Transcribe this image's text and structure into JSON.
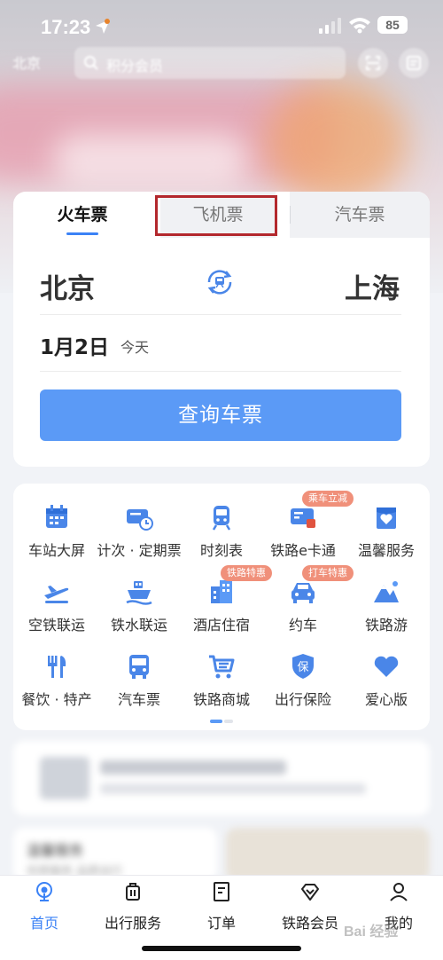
{
  "status_bar": {
    "time": "17:23",
    "battery": "85"
  },
  "header": {
    "city": "北京",
    "search_placeholder": "积分会员"
  },
  "booking": {
    "tabs": [
      {
        "label": "火车票",
        "active": true
      },
      {
        "label": "飞机票",
        "active": false
      },
      {
        "label": "汽车票",
        "active": false
      }
    ],
    "from_city": "北京",
    "to_city": "上海",
    "date": "1月2日",
    "date_note": "今天",
    "query_button": "查询车票"
  },
  "services": [
    {
      "label": "车站大屏",
      "icon": "station-screen-icon"
    },
    {
      "label": "计次 · 定期票",
      "icon": "ticket-pass-icon"
    },
    {
      "label": "时刻表",
      "icon": "train-icon"
    },
    {
      "label": "铁路e卡通",
      "icon": "e-card-icon",
      "badge": "乘车立减"
    },
    {
      "label": "温馨服务",
      "icon": "care-service-icon"
    },
    {
      "label": "空铁联运",
      "icon": "air-rail-icon"
    },
    {
      "label": "铁水联运",
      "icon": "ship-rail-icon"
    },
    {
      "label": "酒店住宿",
      "icon": "hotel-icon",
      "badge": "铁路特惠"
    },
    {
      "label": "约车",
      "icon": "car-icon",
      "badge": "打车特惠"
    },
    {
      "label": "铁路游",
      "icon": "mountain-travel-icon"
    },
    {
      "label": "餐饮 · 特产",
      "icon": "dining-icon"
    },
    {
      "label": "汽车票",
      "icon": "bus-icon"
    },
    {
      "label": "铁路商城",
      "icon": "shopping-cart-icon"
    },
    {
      "label": "出行保险",
      "icon": "insurance-shield-icon",
      "icon_text": "保"
    },
    {
      "label": "爱心版",
      "icon": "heart-icon"
    }
  ],
  "lower": {
    "promo_title": "温馨服务",
    "promo_sub": "优质服务 品质出行"
  },
  "nav": [
    {
      "label": "首页",
      "icon": "home-icon",
      "active": true
    },
    {
      "label": "出行服务",
      "icon": "luggage-icon",
      "active": false
    },
    {
      "label": "订单",
      "icon": "order-icon",
      "active": false
    },
    {
      "label": "铁路会员",
      "icon": "member-diamond-icon",
      "active": false
    },
    {
      "label": "我的",
      "icon": "profile-icon",
      "active": false
    }
  ],
  "watermark": "Bai 经验",
  "colors": {
    "accent": "#3b82f6",
    "button": "#5b9af6",
    "badge": "#f0907a",
    "highlight": "#b3282d"
  }
}
